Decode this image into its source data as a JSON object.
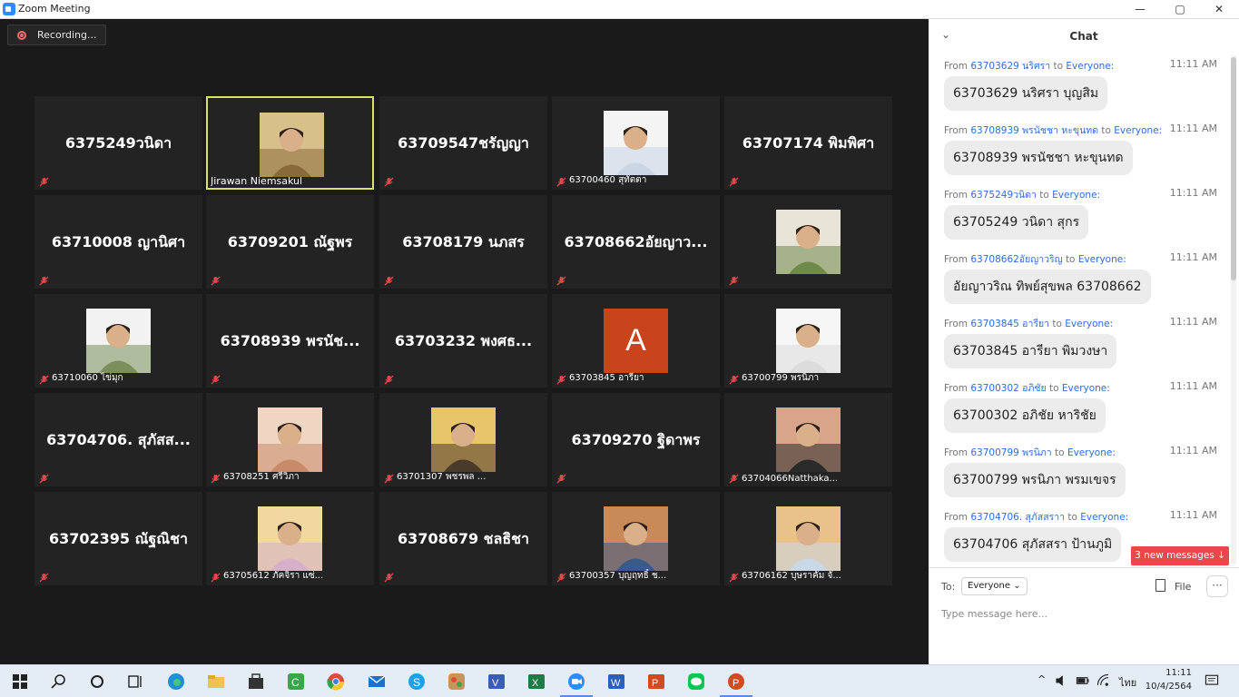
{
  "window": {
    "title": "Zoom Meeting",
    "minimize": "—",
    "maximize": "▢",
    "close": "✕"
  },
  "recording": {
    "label": "Recording..."
  },
  "tiles": [
    {
      "type": "name",
      "text": "6375249วนิดา"
    },
    {
      "type": "photo",
      "label": "Jirawan Niemsakul",
      "speaking": true
    },
    {
      "type": "name",
      "text": "63709547ชรัญญา"
    },
    {
      "type": "photo",
      "label": "63700460 สุทัตตา"
    },
    {
      "type": "name",
      "text": "63707174 พิมพิศา"
    },
    {
      "type": "name",
      "text": "63710008 ญานิศา"
    },
    {
      "type": "name",
      "text": "63709201 ณัฐพร"
    },
    {
      "type": "name",
      "text": "63708179 นภสร"
    },
    {
      "type": "name",
      "text": "63708662อัยญาว..."
    },
    {
      "type": "photo",
      "label": ""
    },
    {
      "type": "photo",
      "label": "63710060 ไข่มุก"
    },
    {
      "type": "name",
      "text": "63708939 พรนัช..."
    },
    {
      "type": "name",
      "text": "63703232 พงศธ..."
    },
    {
      "type": "letter",
      "letter": "A",
      "label": "63703845 อารียา"
    },
    {
      "type": "photo",
      "label": "63700799 พรนิภา"
    },
    {
      "type": "name",
      "text": "63704706. สุภัสส..."
    },
    {
      "type": "photo",
      "label": "63708251 ศรีวิภา"
    },
    {
      "type": "photo",
      "label": "63701307 พชรพล ..."
    },
    {
      "type": "name",
      "text": "63709270 ฐิดาพร"
    },
    {
      "type": "photo",
      "label": "63704066Natthaka..."
    },
    {
      "type": "name",
      "text": "63702395 ณัฐณิชา"
    },
    {
      "type": "photo",
      "label": "63705612 ภัคจิรา แซ่..."
    },
    {
      "type": "name",
      "text": "63708679 ชลธิชา"
    },
    {
      "type": "photo",
      "label": "63700357 บุญฤทธิ์ ช..."
    },
    {
      "type": "photo",
      "label": "63706162 บุษราคัม จั..."
    }
  ],
  "chat": {
    "title": "Chat",
    "from_prefix": "From",
    "to_word": "to",
    "everyone": "Everyone:",
    "messages": [
      {
        "sender": "63703629 นริศรา",
        "time": "11:11 AM",
        "text": "63703629 นริศรา บุญสิม"
      },
      {
        "sender": "63708939 พรนัชชา หะขุนทด",
        "time": "11:11 AM",
        "text": "63708939 พรนัชชา หะขุนทด"
      },
      {
        "sender": "6375249วนิดา",
        "time": "11:11 AM",
        "text": "63705249 วนิดา สุกร"
      },
      {
        "sender": "63708662อัยญาวริญ",
        "time": "11:11 AM",
        "text": "อัยญาวริณ ทิพย์สุขพล 63708662"
      },
      {
        "sender": "63703845 อารียา",
        "time": "11:11 AM",
        "text": "63703845 อารียา พิมวงษา"
      },
      {
        "sender": "63700302 อภิชัย",
        "time": "11:11 AM",
        "text": "63700302 อภิชัย หาริชัย"
      },
      {
        "sender": "63700799 พรนิภา",
        "time": "11:11 AM",
        "text": "63700799 พรนิภา พรมเขจร"
      },
      {
        "sender": "63704706. สุภัสสราา",
        "time": "11:11 AM",
        "text": "63704706 สุภัสสรา ป้านภูมิ"
      }
    ],
    "new_messages": "3 new messages ↓",
    "to_label": "To:",
    "to_value": "Everyone ⌄",
    "file_label": "File",
    "more_label": "···",
    "input_placeholder": "Type message here..."
  },
  "taskbar": {
    "language": "ไทย",
    "time": "11:11",
    "date": "10/4/2564"
  }
}
